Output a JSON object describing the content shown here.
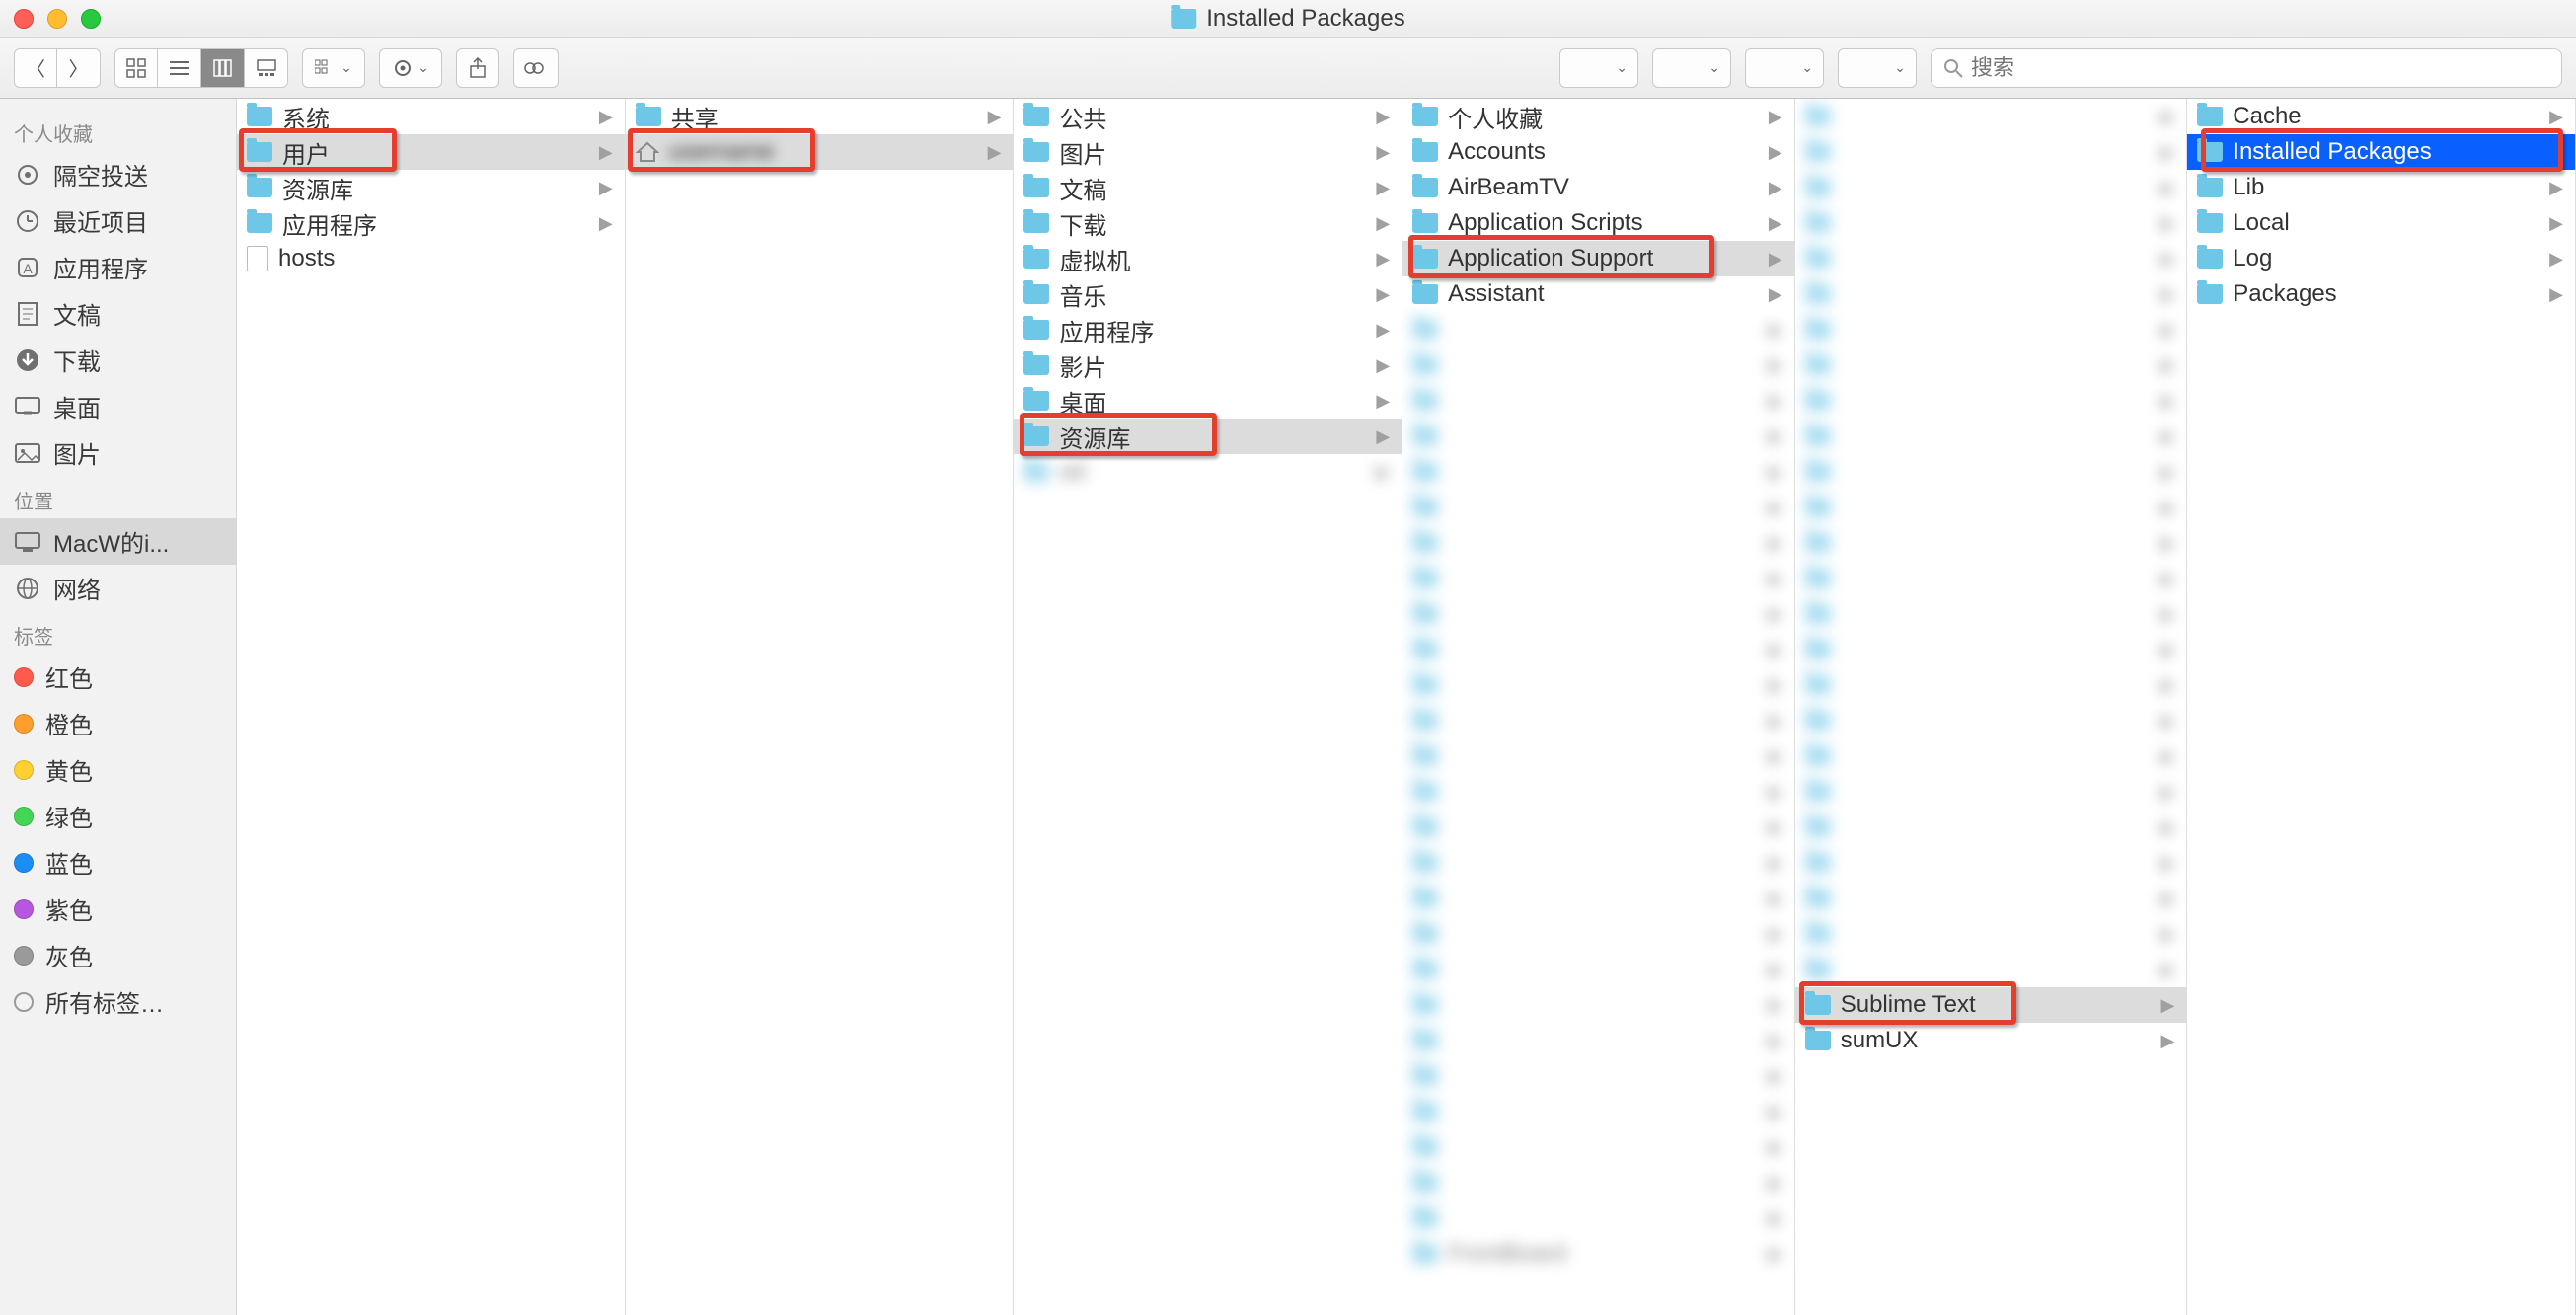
{
  "window": {
    "title": "Installed Packages"
  },
  "toolbar": {
    "search_placeholder": "搜索"
  },
  "sidebar": {
    "sections": [
      {
        "label": "个人收藏",
        "items": [
          {
            "icon": "airdrop",
            "label": "隔空投送"
          },
          {
            "icon": "clock",
            "label": "最近项目"
          },
          {
            "icon": "app",
            "label": "应用程序"
          },
          {
            "icon": "doc",
            "label": "文稿"
          },
          {
            "icon": "download",
            "label": "下载"
          },
          {
            "icon": "desktop",
            "label": "桌面"
          },
          {
            "icon": "picture",
            "label": "图片"
          }
        ]
      },
      {
        "label": "位置",
        "items": [
          {
            "icon": "computer",
            "label": "MacW的i...",
            "selected": true
          },
          {
            "icon": "globe",
            "label": "网络"
          }
        ]
      },
      {
        "label": "标签",
        "items": [
          {
            "color": "#ff5b4d",
            "label": "红色"
          },
          {
            "color": "#ff9e2c",
            "label": "橙色"
          },
          {
            "color": "#ffd02f",
            "label": "黄色"
          },
          {
            "color": "#43d554",
            "label": "绿色"
          },
          {
            "color": "#1c8ef3",
            "label": "蓝色"
          },
          {
            "color": "#b757e0",
            "label": "紫色"
          },
          {
            "color": "#9a9a9a",
            "label": "灰色"
          },
          {
            "color": "transparent",
            "label": "所有标签…",
            "outline": true
          }
        ]
      }
    ]
  },
  "columns": [
    {
      "highlight_index": 1,
      "items": [
        {
          "icon": "folder",
          "label": "系统",
          "arrow": true
        },
        {
          "icon": "folder",
          "label": "用户",
          "arrow": true,
          "selected": true
        },
        {
          "icon": "folder",
          "label": "资源库",
          "arrow": true
        },
        {
          "icon": "folder",
          "label": "应用程序",
          "arrow": true
        },
        {
          "icon": "file",
          "label": "hosts",
          "arrow": false
        }
      ]
    },
    {
      "highlight_index": 1,
      "items": [
        {
          "icon": "folder",
          "label": "共享",
          "arrow": true
        },
        {
          "icon": "home",
          "label": "",
          "arrow": true,
          "selected": true,
          "blur_label": true
        }
      ]
    },
    {
      "highlight_index": 9,
      "items": [
        {
          "icon": "folder",
          "label": "公共",
          "arrow": true
        },
        {
          "icon": "folder",
          "label": "图片",
          "arrow": true
        },
        {
          "icon": "folder",
          "label": "文稿",
          "arrow": true
        },
        {
          "icon": "folder",
          "label": "下载",
          "arrow": true
        },
        {
          "icon": "folder",
          "label": "虚拟机",
          "arrow": true
        },
        {
          "icon": "folder",
          "label": "音乐",
          "arrow": true
        },
        {
          "icon": "folder",
          "label": "应用程序",
          "arrow": true
        },
        {
          "icon": "folder",
          "label": "影片",
          "arrow": true
        },
        {
          "icon": "folder",
          "label": "桌面",
          "arrow": true
        },
        {
          "icon": "folder",
          "label": "资源库",
          "arrow": true,
          "selected": true
        },
        {
          "icon": "folder",
          "label": "ad",
          "arrow": true,
          "blurred": true
        }
      ]
    },
    {
      "highlight_index": 4,
      "items": [
        {
          "icon": "folder",
          "label": "个人收藏",
          "arrow": true
        },
        {
          "icon": "folder",
          "label": "Accounts",
          "arrow": true
        },
        {
          "icon": "folder",
          "label": "AirBeamTV",
          "arrow": true
        },
        {
          "icon": "folder",
          "label": "Application Scripts",
          "arrow": true
        },
        {
          "icon": "folder",
          "label": "Application Support",
          "arrow": true,
          "selected": true
        },
        {
          "icon": "folder",
          "label": "Assistant",
          "arrow": true
        },
        {
          "icon": "folder",
          "label": "",
          "arrow": true,
          "blurred": true
        },
        {
          "icon": "folder",
          "label": "",
          "arrow": true,
          "blurred": true
        },
        {
          "icon": "folder",
          "label": "",
          "arrow": true,
          "blurred": true
        },
        {
          "icon": "folder",
          "label": "",
          "arrow": true,
          "blurred": true
        },
        {
          "icon": "folder",
          "label": "",
          "arrow": true,
          "blurred": true
        },
        {
          "icon": "folder",
          "label": "",
          "arrow": true,
          "blurred": true
        },
        {
          "icon": "folder",
          "label": "",
          "arrow": true,
          "blurred": true
        },
        {
          "icon": "folder",
          "label": "",
          "arrow": true,
          "blurred": true
        },
        {
          "icon": "folder",
          "label": "",
          "arrow": true,
          "blurred": true
        },
        {
          "icon": "folder",
          "label": "",
          "arrow": true,
          "blurred": true
        },
        {
          "icon": "folder",
          "label": "",
          "arrow": true,
          "blurred": true
        },
        {
          "icon": "folder",
          "label": "",
          "arrow": true,
          "blurred": true
        },
        {
          "icon": "folder",
          "label": "",
          "arrow": true,
          "blurred": true
        },
        {
          "icon": "folder",
          "label": "",
          "arrow": true,
          "blurred": true
        },
        {
          "icon": "folder",
          "label": "",
          "arrow": true,
          "blurred": true
        },
        {
          "icon": "folder",
          "label": "",
          "arrow": true,
          "blurred": true
        },
        {
          "icon": "folder",
          "label": "",
          "arrow": true,
          "blurred": true
        },
        {
          "icon": "folder",
          "label": "",
          "arrow": true,
          "blurred": true
        },
        {
          "icon": "folder",
          "label": "",
          "arrow": true,
          "blurred": true
        },
        {
          "icon": "folder",
          "label": "",
          "arrow": true,
          "blurred": true
        },
        {
          "icon": "folder",
          "label": "",
          "arrow": true,
          "blurred": true
        },
        {
          "icon": "folder",
          "label": "",
          "arrow": true,
          "blurred": true
        },
        {
          "icon": "folder",
          "label": "",
          "arrow": true,
          "blurred": true
        },
        {
          "icon": "folder",
          "label": "",
          "arrow": true,
          "blurred": true
        },
        {
          "icon": "folder",
          "label": "",
          "arrow": true,
          "blurred": true
        },
        {
          "icon": "folder",
          "label": "",
          "arrow": true,
          "blurred": true
        },
        {
          "icon": "folder",
          "label": "FrontBoard",
          "arrow": true,
          "blurred": true
        }
      ]
    },
    {
      "highlight_index": 25,
      "items": [
        {
          "icon": "folder",
          "label": "",
          "arrow": true,
          "blurred": true
        },
        {
          "icon": "folder",
          "label": "",
          "arrow": true,
          "blurred": true
        },
        {
          "icon": "folder",
          "label": "",
          "arrow": true,
          "blurred": true
        },
        {
          "icon": "folder",
          "label": "",
          "arrow": true,
          "blurred": true
        },
        {
          "icon": "folder",
          "label": "",
          "arrow": true,
          "blurred": true
        },
        {
          "icon": "folder",
          "label": "",
          "arrow": true,
          "blurred": true
        },
        {
          "icon": "folder",
          "label": "",
          "arrow": true,
          "blurred": true
        },
        {
          "icon": "folder",
          "label": "",
          "arrow": true,
          "blurred": true
        },
        {
          "icon": "folder",
          "label": "",
          "arrow": true,
          "blurred": true
        },
        {
          "icon": "folder",
          "label": "",
          "arrow": true,
          "blurred": true
        },
        {
          "icon": "folder",
          "label": "",
          "arrow": true,
          "blurred": true
        },
        {
          "icon": "folder",
          "label": "",
          "arrow": true,
          "blurred": true
        },
        {
          "icon": "folder",
          "label": "",
          "arrow": true,
          "blurred": true
        },
        {
          "icon": "folder",
          "label": "",
          "arrow": true,
          "blurred": true
        },
        {
          "icon": "folder",
          "label": "",
          "arrow": true,
          "blurred": true
        },
        {
          "icon": "folder",
          "label": "",
          "arrow": true,
          "blurred": true
        },
        {
          "icon": "folder",
          "label": "",
          "arrow": true,
          "blurred": true
        },
        {
          "icon": "folder",
          "label": "",
          "arrow": true,
          "blurred": true
        },
        {
          "icon": "folder",
          "label": "",
          "arrow": true,
          "blurred": true
        },
        {
          "icon": "folder",
          "label": "",
          "arrow": true,
          "blurred": true
        },
        {
          "icon": "folder",
          "label": "",
          "arrow": true,
          "blurred": true
        },
        {
          "icon": "folder",
          "label": "",
          "arrow": true,
          "blurred": true
        },
        {
          "icon": "folder",
          "label": "",
          "arrow": true,
          "blurred": true
        },
        {
          "icon": "folder",
          "label": "",
          "arrow": true,
          "blurred": true
        },
        {
          "icon": "folder",
          "label": "",
          "arrow": true,
          "blurred": true
        },
        {
          "icon": "folder",
          "label": "Sublime Text",
          "arrow": true,
          "selected": true
        },
        {
          "icon": "folder",
          "label": "sumUX",
          "arrow": true
        }
      ]
    },
    {
      "highlight_index": 1,
      "items": [
        {
          "icon": "folder",
          "label": "Cache",
          "arrow": true
        },
        {
          "icon": "folder",
          "label": "Installed Packages",
          "arrow": false,
          "selected_blue": true
        },
        {
          "icon": "folder",
          "label": "Lib",
          "arrow": true
        },
        {
          "icon": "folder",
          "label": "Local",
          "arrow": true
        },
        {
          "icon": "folder",
          "label": "Log",
          "arrow": true
        },
        {
          "icon": "folder",
          "label": "Packages",
          "arrow": true
        }
      ]
    }
  ]
}
